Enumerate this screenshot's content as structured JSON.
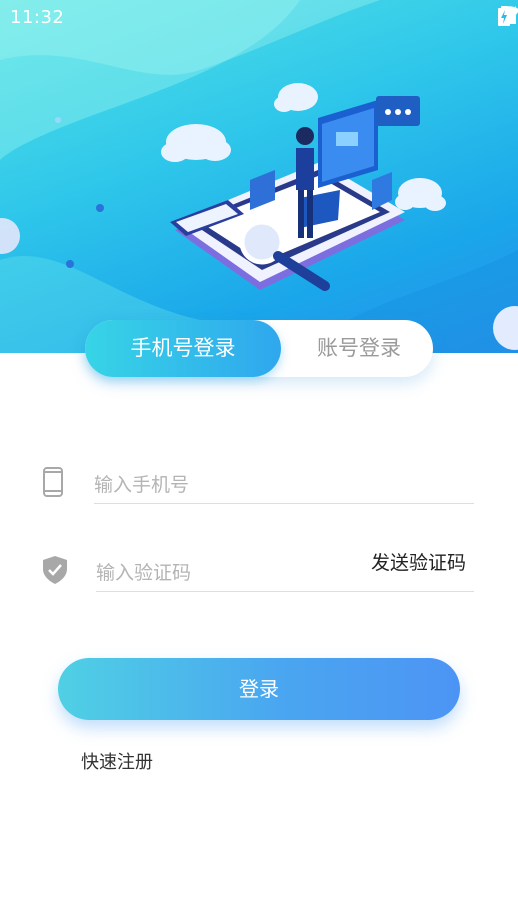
{
  "status_bar": {
    "time": "11:32",
    "icons": [
      "wifi-icon",
      "signal-icon",
      "battery-charging-icon"
    ]
  },
  "colors": {
    "accent_start": "#37d4e6",
    "accent_end": "#2fa7ee",
    "button_start": "#4fd0e4",
    "button_end": "#4c94f4",
    "hero_bg": "#2fc7ea"
  },
  "tabs": {
    "phone_login": "手机号登录",
    "account_login": "账号登录",
    "active": "phone_login"
  },
  "form": {
    "phone_placeholder": "输入手机号",
    "code_placeholder": "输入验证码",
    "send_code_label": "发送验证码"
  },
  "actions": {
    "login_label": "登录",
    "register_label": "快速注册"
  }
}
